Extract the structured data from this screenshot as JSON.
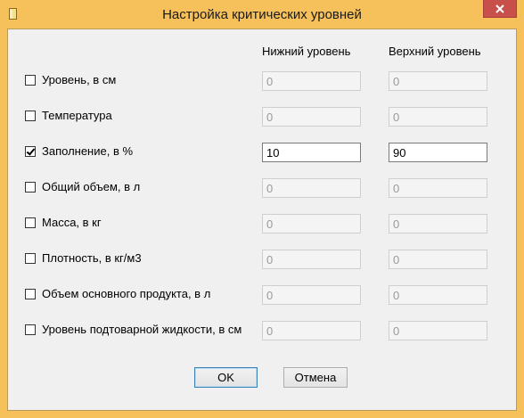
{
  "window": {
    "title": "Настройка критических уровней",
    "accent_color": "#f6c15a",
    "icon": "app-icon",
    "close_icon": "close-icon"
  },
  "columns": {
    "lower": "Нижний уровень",
    "upper": "Верхний уровень"
  },
  "rows": [
    {
      "label": "Уровень, в см",
      "checked": false,
      "lower": "0",
      "upper": "0"
    },
    {
      "label": "Температура",
      "checked": false,
      "lower": "0",
      "upper": "0"
    },
    {
      "label": "Заполнение, в %",
      "checked": true,
      "lower": "10",
      "upper": "90"
    },
    {
      "label": "Общий объем, в л",
      "checked": false,
      "lower": "0",
      "upper": "0"
    },
    {
      "label": "Масса, в кг",
      "checked": false,
      "lower": "0",
      "upper": "0"
    },
    {
      "label": "Плотность, в кг/м3",
      "checked": false,
      "lower": "0",
      "upper": "0"
    },
    {
      "label": "Объем основного продукта, в л",
      "checked": false,
      "lower": "0",
      "upper": "0"
    },
    {
      "label": "Уровень подтоварной жидкости, в см",
      "checked": false,
      "lower": "0",
      "upper": "0"
    }
  ],
  "buttons": {
    "ok": "OK",
    "cancel": "Отмена"
  }
}
